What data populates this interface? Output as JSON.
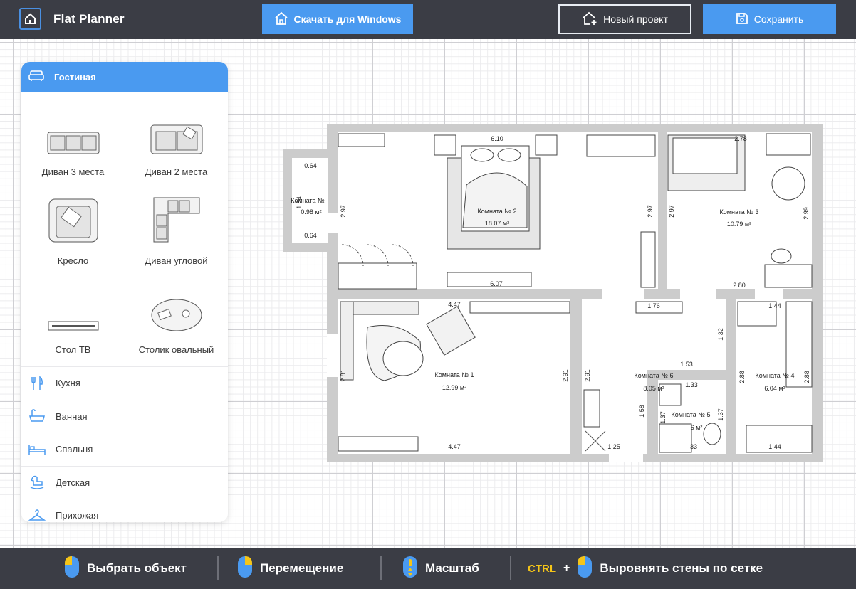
{
  "app": {
    "title": "Flat Planner"
  },
  "toolbar": {
    "download_label": "Скачать для Windows",
    "new_project_label": "Новый проект",
    "save_label": "Сохранить"
  },
  "colors": {
    "accent": "#4a9af0",
    "bar": "#3b3d45",
    "wall": "#c8c8c8",
    "hint_key": "#f5c518"
  },
  "panel": {
    "active_category": "Гостиная",
    "items": [
      {
        "label": "Диван 3 места",
        "icon": "sofa-3-icon"
      },
      {
        "label": "Диван 2 места",
        "icon": "sofa-2-icon"
      },
      {
        "label": "Кресло",
        "icon": "armchair-icon"
      },
      {
        "label": "Диван угловой",
        "icon": "corner-sofa-icon"
      },
      {
        "label": "Стол ТВ",
        "icon": "tv-table-icon"
      },
      {
        "label": "Столик овальный",
        "icon": "oval-table-icon"
      }
    ],
    "categories": [
      {
        "label": "Кухня",
        "icon": "fork-knife-icon"
      },
      {
        "label": "Ванная",
        "icon": "bathtub-icon"
      },
      {
        "label": "Спальня",
        "icon": "bed-icon"
      },
      {
        "label": "Детская",
        "icon": "rocking-horse-icon"
      },
      {
        "label": "Прихожая",
        "icon": "hanger-icon"
      }
    ]
  },
  "plan": {
    "rooms": [
      {
        "name": "Комната №",
        "area": "0.98 м²"
      },
      {
        "name": "Комната № 2",
        "area": "18.07 м²"
      },
      {
        "name": "Комната № 3",
        "area": "10.79 м²"
      },
      {
        "name": "Комната № 1",
        "area": "12.99 м²"
      },
      {
        "name": "Комната № 6",
        "area": "8.05 м²"
      },
      {
        "name": "Комната № 5",
        "area": "6 м²"
      },
      {
        "name": "Комната № 4",
        "area": "6.04 м²"
      }
    ],
    "dimensions": {
      "balcony_top": "0.64",
      "balcony_bottom": "0.64",
      "balcony_side": "1.54",
      "r2_top": "6.10",
      "r2_bottom": "6.07",
      "r2_left": "2.97",
      "r2_right": "2.97",
      "r3_top": "2.78",
      "r3_bottom": "2.80",
      "r3_left": "2.97",
      "r3_right": "2.99",
      "r1_top": "4.47",
      "r1_bottom": "4.47",
      "r1_left": "2.81",
      "r1_right": "2.91",
      "r6_top": "1.76",
      "r6_mid": "1.53",
      "r6_side": "1.32",
      "r6_left": "2.91",
      "r6_lower": "1.58",
      "r6_bottom": "1.25",
      "r5_top": "1.33",
      "r5_left": "1.37",
      "r5_right": "1.37",
      "r5_bottom": "33",
      "r4_top": "1.44",
      "r4_bottom": "1.44",
      "r4_left": "2.88",
      "r4_right": "2.88"
    }
  },
  "hints": [
    {
      "label": "Выбрать объект",
      "icon": "mouse-left-icon"
    },
    {
      "label": "Перемещение",
      "icon": "mouse-right-icon"
    },
    {
      "label": "Масштаб",
      "icon": "mouse-wheel-icon"
    },
    {
      "key": "CTRL",
      "plus": "+",
      "label": "Выровнять стены по сетке",
      "icon": "mouse-left-icon"
    }
  ]
}
